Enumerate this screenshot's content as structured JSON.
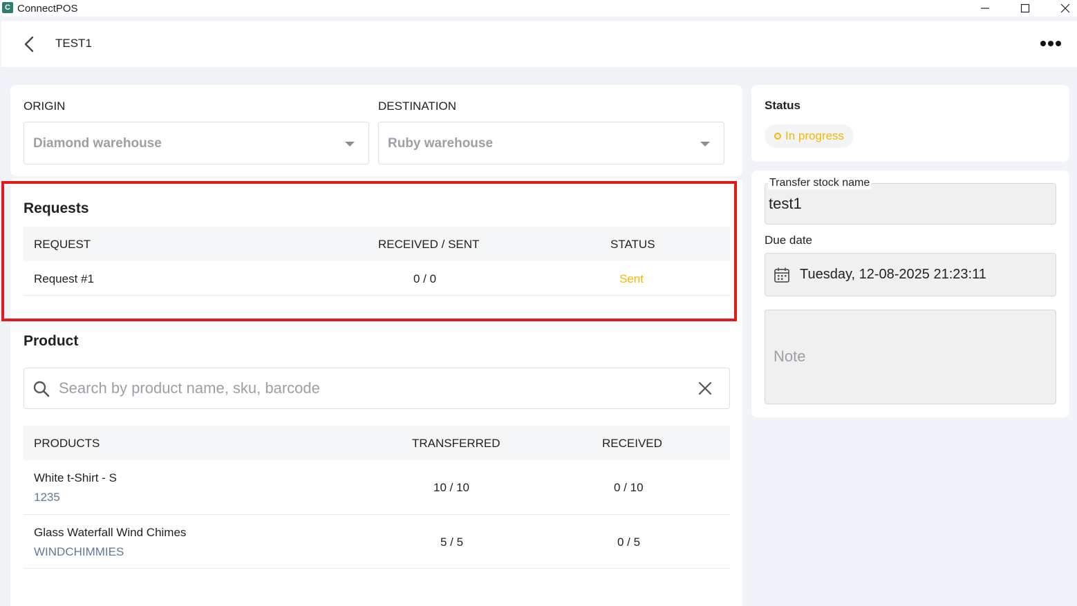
{
  "window": {
    "app_title": "ConnectPOS",
    "logo_glyph": "C"
  },
  "header": {
    "title": "TEST1"
  },
  "transfer": {
    "origin_label": "ORIGIN",
    "origin_value": "Diamond warehouse",
    "destination_label": "DESTINATION",
    "destination_value": "Ruby warehouse"
  },
  "requests": {
    "title": "Requests",
    "columns": [
      "REQUEST",
      "RECEIVED / SENT",
      "STATUS"
    ],
    "rows": [
      {
        "request": "Request #1",
        "received_sent": "0 / 0",
        "status": "Sent"
      }
    ]
  },
  "products": {
    "title": "Product",
    "search_placeholder": "Search by product name, sku, barcode",
    "columns": [
      "PRODUCTS",
      "TRANSFERRED",
      "RECEIVED"
    ],
    "rows": [
      {
        "name": "White t-Shirt - S",
        "sku": "1235",
        "transferred": "10 / 10",
        "received": "0 / 10"
      },
      {
        "name": "Glass Waterfall Wind Chimes",
        "sku": "WINDCHIMMIES",
        "transferred": "5 / 5",
        "received": "0 / 5"
      }
    ]
  },
  "status_panel": {
    "label": "Status",
    "value": "In progress"
  },
  "details": {
    "name_label": "Transfer stock name",
    "name_value": "test1",
    "due_label": "Due date",
    "due_value": "Tuesday, 12-08-2025 21:23:11",
    "note_placeholder": "Note"
  },
  "colors": {
    "accent_yellow": "#f5b800",
    "highlight_red": "#e21a1a",
    "sku_blue": "#5f7a95"
  }
}
